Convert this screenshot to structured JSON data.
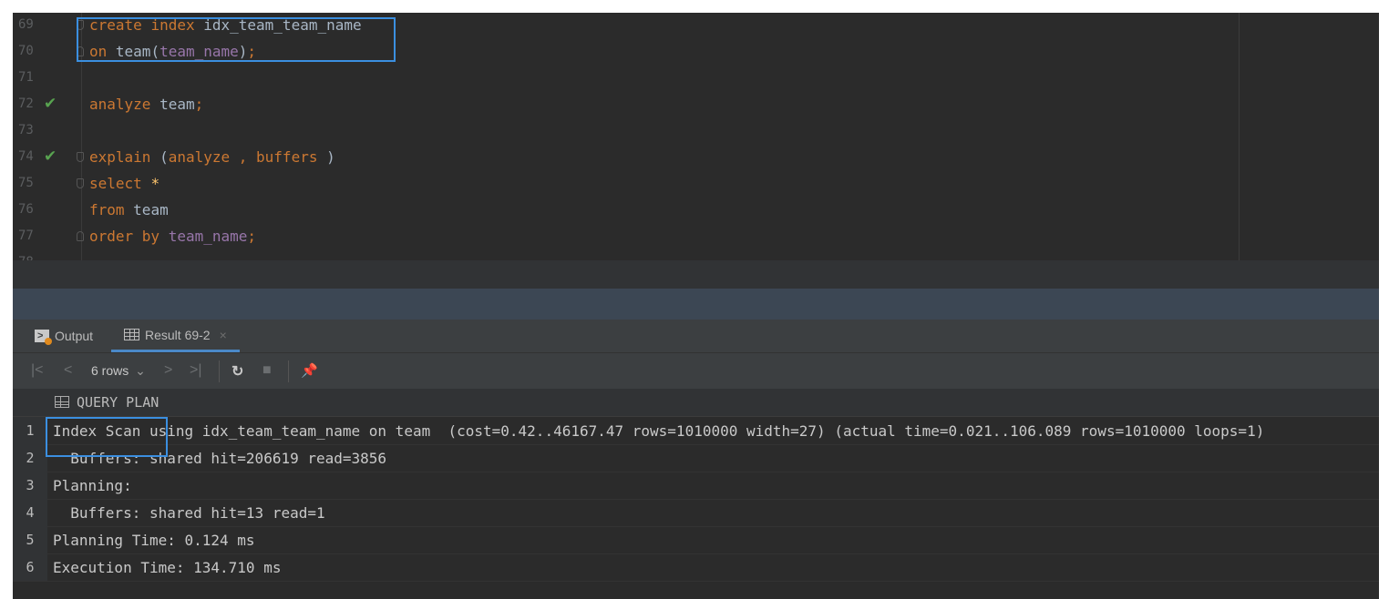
{
  "editor": {
    "lines": [
      {
        "num": "69",
        "tokens": [
          [
            "kw",
            "create "
          ],
          [
            "kw",
            "index "
          ],
          [
            "id",
            "idx_team_team_name"
          ]
        ]
      },
      {
        "num": "70",
        "tokens": [
          [
            "kw",
            "on "
          ],
          [
            "id",
            "team("
          ],
          [
            "col",
            "team_name"
          ],
          [
            "id",
            ")"
          ],
          [
            "kw",
            ";"
          ]
        ]
      },
      {
        "num": "71",
        "tokens": []
      },
      {
        "num": "72",
        "tokens": [
          [
            "kw",
            "analyze "
          ],
          [
            "id",
            "team"
          ],
          [
            "kw",
            ";"
          ]
        ]
      },
      {
        "num": "73",
        "tokens": []
      },
      {
        "num": "74",
        "tokens": [
          [
            "kw",
            "explain "
          ],
          [
            "id",
            "("
          ],
          [
            "kw",
            "analyze "
          ],
          [
            "kw",
            ", "
          ],
          [
            "kw",
            "buffers "
          ],
          [
            "id",
            ")"
          ]
        ]
      },
      {
        "num": "75",
        "tokens": [
          [
            "kw",
            "select "
          ],
          [
            "star",
            "*"
          ]
        ]
      },
      {
        "num": "76",
        "tokens": [
          [
            "kw",
            "from "
          ],
          [
            "id",
            "team"
          ]
        ]
      },
      {
        "num": "77",
        "tokens": [
          [
            "kw",
            "order by "
          ],
          [
            "col",
            "team_name"
          ],
          [
            "kw",
            ";"
          ]
        ]
      },
      {
        "num": "78",
        "tokens": []
      }
    ]
  },
  "tool_window": {
    "tabs": [
      {
        "label": "Output",
        "icon": "console-output-icon"
      },
      {
        "label": "Result 69-2",
        "icon": "table-grid-icon",
        "close": "×"
      }
    ],
    "toolbar": {
      "first": "|<",
      "prev": "<",
      "rows_label": "6 rows",
      "rows_caret": "⌄",
      "next": ">",
      "last": ">|",
      "refresh": "↻",
      "stop": "■",
      "pin": "📌"
    },
    "grid": {
      "column": "QUERY PLAN",
      "rows": [
        {
          "n": "1",
          "value": "Index Scan using idx_team_team_name on team  (cost=0.42..46167.47 rows=1010000 width=27) (actual time=0.021..106.089 rows=1010000 loops=1)"
        },
        {
          "n": "2",
          "value": "  Buffers: shared hit=206619 read=3856"
        },
        {
          "n": "3",
          "value": "Planning:"
        },
        {
          "n": "4",
          "value": "  Buffers: shared hit=13 read=1"
        },
        {
          "n": "5",
          "value": "Planning Time: 0.124 ms"
        },
        {
          "n": "6",
          "value": "Execution Time: 134.710 ms"
        }
      ]
    }
  },
  "colors": {
    "keyword": "#cc7832",
    "identifier": "#a9b7c6",
    "column": "#9876aa",
    "highlight": "#3b8fe0",
    "check": "#58a350"
  }
}
